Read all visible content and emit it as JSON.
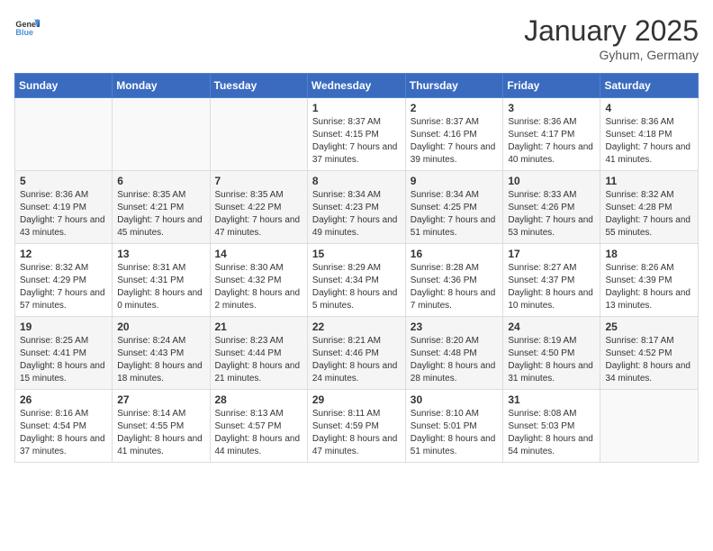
{
  "header": {
    "logo_general": "General",
    "logo_blue": "Blue",
    "month": "January 2025",
    "location": "Gyhum, Germany"
  },
  "weekdays": [
    "Sunday",
    "Monday",
    "Tuesday",
    "Wednesday",
    "Thursday",
    "Friday",
    "Saturday"
  ],
  "weeks": [
    [
      {
        "day": "",
        "info": ""
      },
      {
        "day": "",
        "info": ""
      },
      {
        "day": "",
        "info": ""
      },
      {
        "day": "1",
        "info": "Sunrise: 8:37 AM\nSunset: 4:15 PM\nDaylight: 7 hours and 37 minutes."
      },
      {
        "day": "2",
        "info": "Sunrise: 8:37 AM\nSunset: 4:16 PM\nDaylight: 7 hours and 39 minutes."
      },
      {
        "day": "3",
        "info": "Sunrise: 8:36 AM\nSunset: 4:17 PM\nDaylight: 7 hours and 40 minutes."
      },
      {
        "day": "4",
        "info": "Sunrise: 8:36 AM\nSunset: 4:18 PM\nDaylight: 7 hours and 41 minutes."
      }
    ],
    [
      {
        "day": "5",
        "info": "Sunrise: 8:36 AM\nSunset: 4:19 PM\nDaylight: 7 hours and 43 minutes."
      },
      {
        "day": "6",
        "info": "Sunrise: 8:35 AM\nSunset: 4:21 PM\nDaylight: 7 hours and 45 minutes."
      },
      {
        "day": "7",
        "info": "Sunrise: 8:35 AM\nSunset: 4:22 PM\nDaylight: 7 hours and 47 minutes."
      },
      {
        "day": "8",
        "info": "Sunrise: 8:34 AM\nSunset: 4:23 PM\nDaylight: 7 hours and 49 minutes."
      },
      {
        "day": "9",
        "info": "Sunrise: 8:34 AM\nSunset: 4:25 PM\nDaylight: 7 hours and 51 minutes."
      },
      {
        "day": "10",
        "info": "Sunrise: 8:33 AM\nSunset: 4:26 PM\nDaylight: 7 hours and 53 minutes."
      },
      {
        "day": "11",
        "info": "Sunrise: 8:32 AM\nSunset: 4:28 PM\nDaylight: 7 hours and 55 minutes."
      }
    ],
    [
      {
        "day": "12",
        "info": "Sunrise: 8:32 AM\nSunset: 4:29 PM\nDaylight: 7 hours and 57 minutes."
      },
      {
        "day": "13",
        "info": "Sunrise: 8:31 AM\nSunset: 4:31 PM\nDaylight: 8 hours and 0 minutes."
      },
      {
        "day": "14",
        "info": "Sunrise: 8:30 AM\nSunset: 4:32 PM\nDaylight: 8 hours and 2 minutes."
      },
      {
        "day": "15",
        "info": "Sunrise: 8:29 AM\nSunset: 4:34 PM\nDaylight: 8 hours and 5 minutes."
      },
      {
        "day": "16",
        "info": "Sunrise: 8:28 AM\nSunset: 4:36 PM\nDaylight: 8 hours and 7 minutes."
      },
      {
        "day": "17",
        "info": "Sunrise: 8:27 AM\nSunset: 4:37 PM\nDaylight: 8 hours and 10 minutes."
      },
      {
        "day": "18",
        "info": "Sunrise: 8:26 AM\nSunset: 4:39 PM\nDaylight: 8 hours and 13 minutes."
      }
    ],
    [
      {
        "day": "19",
        "info": "Sunrise: 8:25 AM\nSunset: 4:41 PM\nDaylight: 8 hours and 15 minutes."
      },
      {
        "day": "20",
        "info": "Sunrise: 8:24 AM\nSunset: 4:43 PM\nDaylight: 8 hours and 18 minutes."
      },
      {
        "day": "21",
        "info": "Sunrise: 8:23 AM\nSunset: 4:44 PM\nDaylight: 8 hours and 21 minutes."
      },
      {
        "day": "22",
        "info": "Sunrise: 8:21 AM\nSunset: 4:46 PM\nDaylight: 8 hours and 24 minutes."
      },
      {
        "day": "23",
        "info": "Sunrise: 8:20 AM\nSunset: 4:48 PM\nDaylight: 8 hours and 28 minutes."
      },
      {
        "day": "24",
        "info": "Sunrise: 8:19 AM\nSunset: 4:50 PM\nDaylight: 8 hours and 31 minutes."
      },
      {
        "day": "25",
        "info": "Sunrise: 8:17 AM\nSunset: 4:52 PM\nDaylight: 8 hours and 34 minutes."
      }
    ],
    [
      {
        "day": "26",
        "info": "Sunrise: 8:16 AM\nSunset: 4:54 PM\nDaylight: 8 hours and 37 minutes."
      },
      {
        "day": "27",
        "info": "Sunrise: 8:14 AM\nSunset: 4:55 PM\nDaylight: 8 hours and 41 minutes."
      },
      {
        "day": "28",
        "info": "Sunrise: 8:13 AM\nSunset: 4:57 PM\nDaylight: 8 hours and 44 minutes."
      },
      {
        "day": "29",
        "info": "Sunrise: 8:11 AM\nSunset: 4:59 PM\nDaylight: 8 hours and 47 minutes."
      },
      {
        "day": "30",
        "info": "Sunrise: 8:10 AM\nSunset: 5:01 PM\nDaylight: 8 hours and 51 minutes."
      },
      {
        "day": "31",
        "info": "Sunrise: 8:08 AM\nSunset: 5:03 PM\nDaylight: 8 hours and 54 minutes."
      },
      {
        "day": "",
        "info": ""
      }
    ]
  ]
}
